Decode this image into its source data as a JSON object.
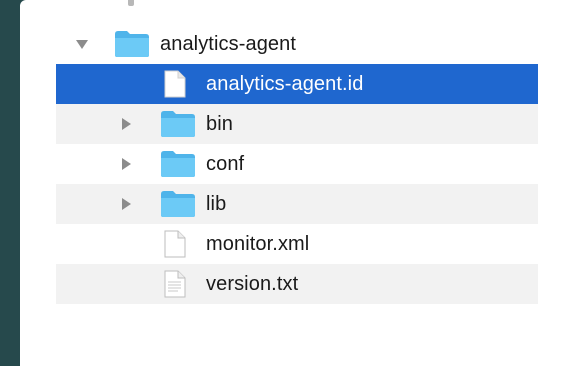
{
  "file_tree": {
    "items": [
      {
        "name": "analytics-agent",
        "type": "folder",
        "expanded": true,
        "depth": 0,
        "icon": "folder-icon"
      },
      {
        "name": "analytics-agent.id",
        "type": "file",
        "depth": 1,
        "selected": true,
        "icon": "document-icon"
      },
      {
        "name": "bin",
        "type": "folder",
        "expanded": false,
        "depth": 1,
        "icon": "folder-icon"
      },
      {
        "name": "conf",
        "type": "folder",
        "expanded": false,
        "depth": 1,
        "icon": "folder-icon"
      },
      {
        "name": "lib",
        "type": "folder",
        "expanded": false,
        "depth": 1,
        "icon": "folder-icon"
      },
      {
        "name": "monitor.xml",
        "type": "file",
        "depth": 1,
        "icon": "document-icon"
      },
      {
        "name": "version.txt",
        "type": "file",
        "depth": 1,
        "icon": "document-icon"
      }
    ]
  },
  "colors": {
    "background": "#26494c",
    "selection": "#1f67cf",
    "folder": "#5bc1f2",
    "stripe": "#f2f2f2"
  }
}
